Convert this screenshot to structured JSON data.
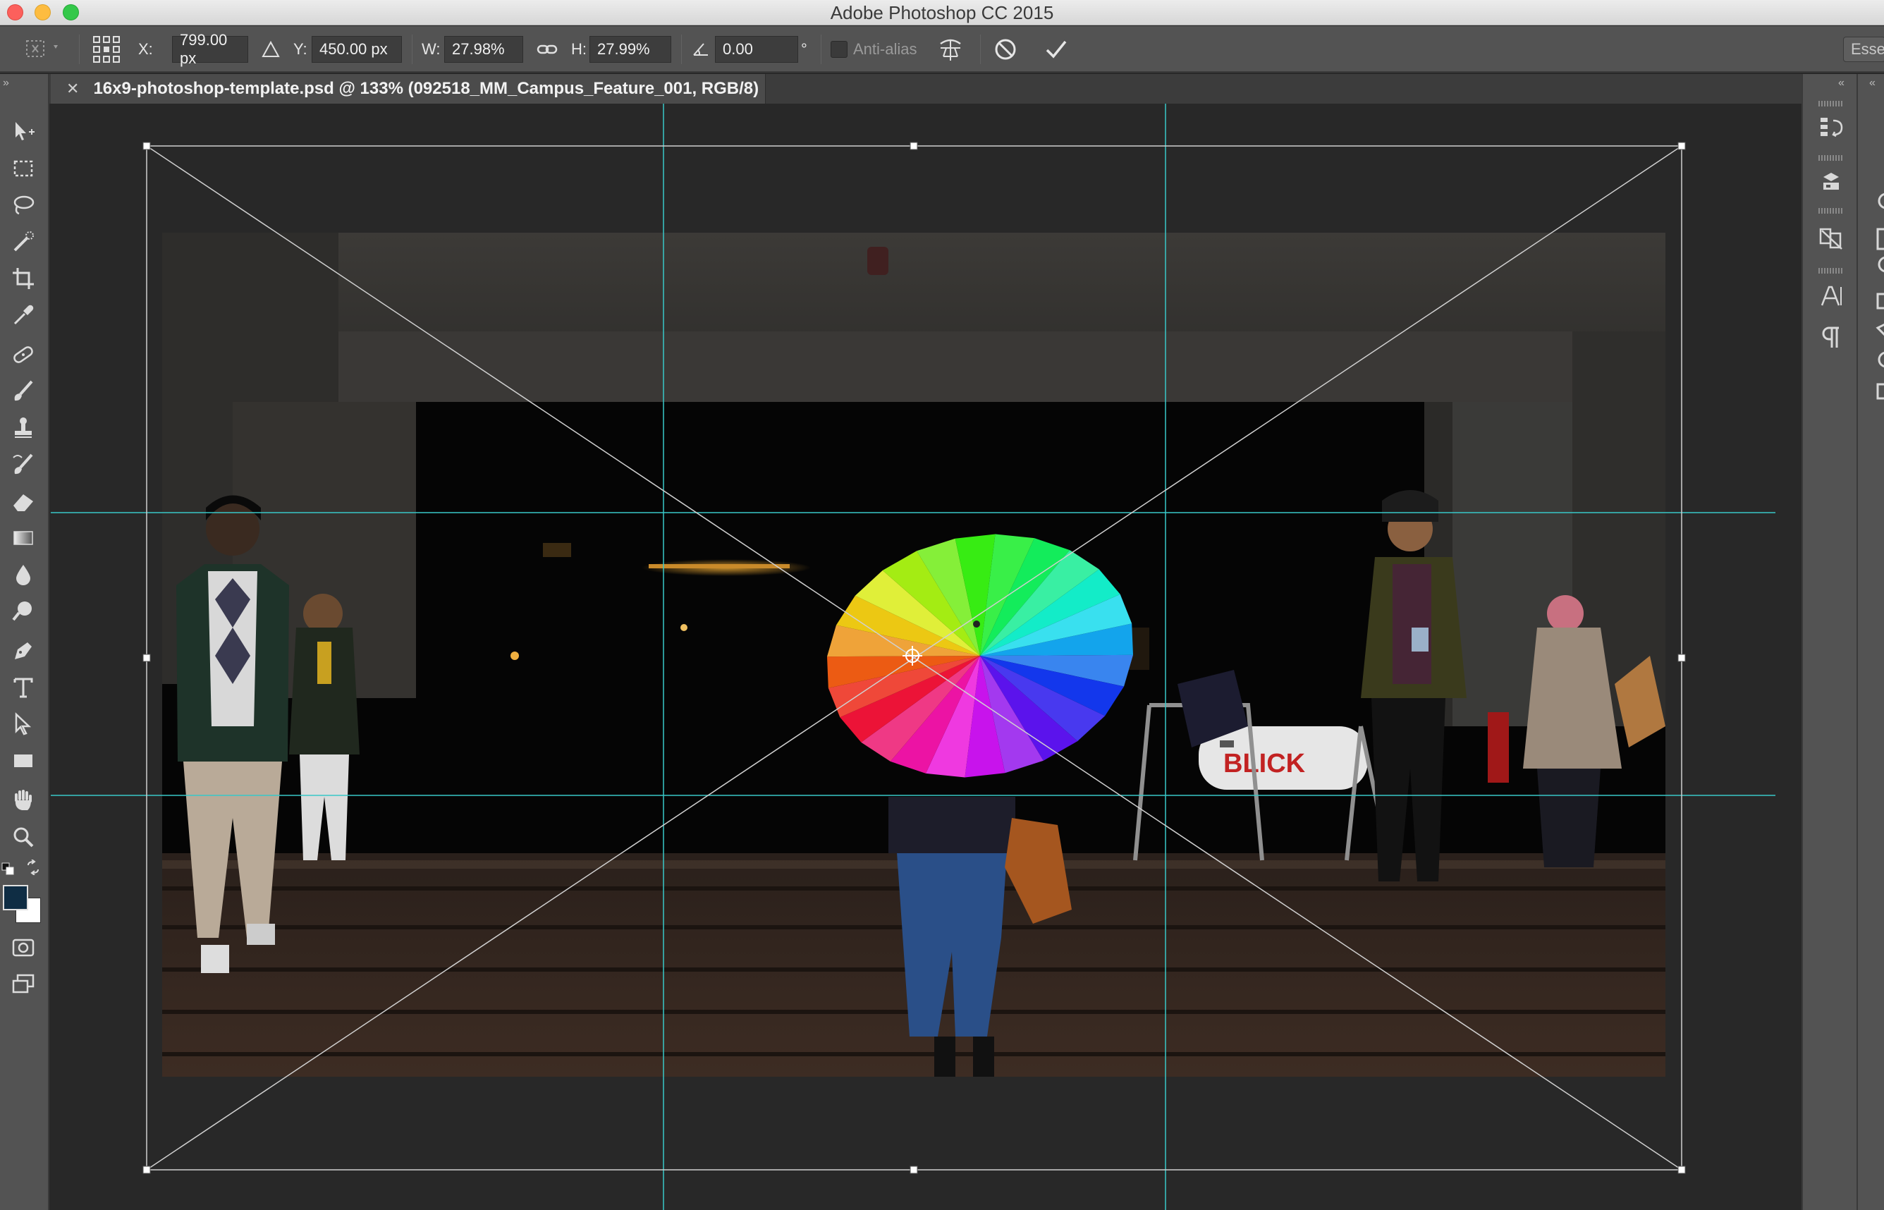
{
  "window": {
    "title": "Adobe Photoshop CC 2015"
  },
  "options": {
    "x_label": "X:",
    "x_value": "799.00 px",
    "y_label": "Y:",
    "y_value": "450.00 px",
    "w_label": "W:",
    "w_value": "27.98%",
    "h_label": "H:",
    "h_value": "27.99%",
    "angle_value": "0.00",
    "angle_unit": "°",
    "antialias_label": "Anti-alias",
    "workspace_label": "Esse"
  },
  "document": {
    "tab_title": "16x9-photoshop-template.psd @ 133% (092518_MM_Campus_Feature_001, RGB/8)"
  },
  "photo": {
    "bag_text": "BLICK"
  },
  "colors": {
    "foreground": "#0f2d44",
    "background": "#ffffff",
    "guide": "#38c8c8"
  },
  "tools": [
    "move-tool",
    "marquee-tool",
    "lasso-tool",
    "quick-select-tool",
    "crop-tool",
    "eyedropper-tool",
    "healing-brush-tool",
    "brush-tool",
    "clone-stamp-tool",
    "history-brush-tool",
    "eraser-tool",
    "gradient-tool",
    "blur-tool",
    "dodge-tool",
    "pen-tool",
    "type-tool",
    "path-select-tool",
    "rectangle-tool",
    "hand-tool",
    "zoom-tool"
  ]
}
